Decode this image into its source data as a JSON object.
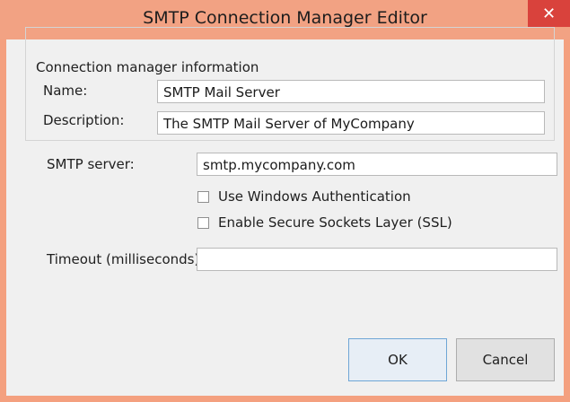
{
  "window": {
    "title": "SMTP Connection Manager Editor",
    "close_icon": "close-icon"
  },
  "group": {
    "title": "Connection manager information",
    "name_label": "Name:",
    "name_value": "SMTP Mail Server",
    "description_label": "Description:",
    "description_value": "The SMTP Mail Server of MyCompany"
  },
  "smtp": {
    "server_label": "SMTP server:",
    "server_value": "smtp.mycompany.com",
    "windows_auth_label": "Use Windows Authentication",
    "ssl_label": "Enable Secure Sockets Layer (SSL)",
    "timeout_label": "Timeout (milliseconds):",
    "timeout_value": ""
  },
  "buttons": {
    "ok": "OK",
    "cancel": "Cancel"
  },
  "colors": {
    "title_bar": "#f2a283",
    "close_button": "#d9423c",
    "client_background": "#f0f0f0"
  }
}
